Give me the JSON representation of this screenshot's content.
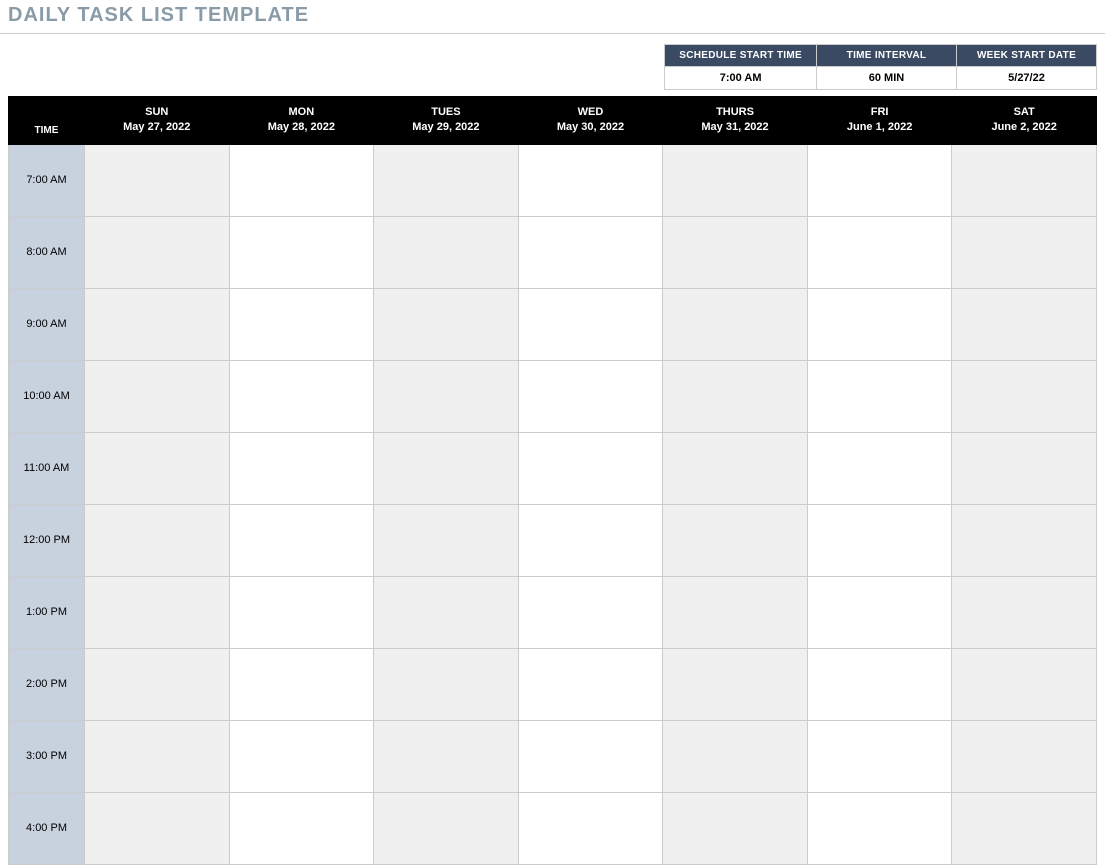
{
  "title": "DAILY TASK LIST TEMPLATE",
  "settings": {
    "headers": [
      "SCHEDULE START TIME",
      "TIME INTERVAL",
      "WEEK START DATE"
    ],
    "values": [
      "7:00 AM",
      "60 MIN",
      "5/27/22"
    ]
  },
  "schedule": {
    "time_header": "TIME",
    "days": [
      {
        "name": "SUN",
        "date": "May 27, 2022"
      },
      {
        "name": "MON",
        "date": "May 28, 2022"
      },
      {
        "name": "TUES",
        "date": "May 29, 2022"
      },
      {
        "name": "WED",
        "date": "May 30, 2022"
      },
      {
        "name": "THURS",
        "date": "May 31, 2022"
      },
      {
        "name": "FRI",
        "date": "June 1, 2022"
      },
      {
        "name": "SAT",
        "date": "June 2, 2022"
      }
    ],
    "times": [
      "7:00 AM",
      "8:00 AM",
      "9:00 AM",
      "10:00 AM",
      "11:00 AM",
      "12:00 PM",
      "1:00 PM",
      "2:00 PM",
      "3:00 PM",
      "4:00 PM"
    ],
    "shaded_days": [
      0,
      2,
      4,
      6
    ]
  }
}
